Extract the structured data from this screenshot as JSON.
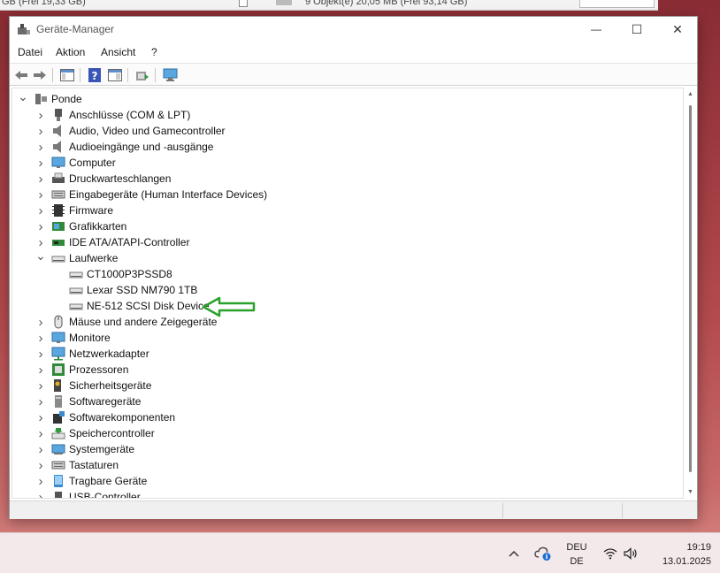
{
  "background_window": {
    "text_left": "GB  (Frei 19,33 GB)",
    "text_right": "9 Objekt(e)   20,05 MB  (Frei 93,14 GB)"
  },
  "window": {
    "title": "Geräte-Manager",
    "controls": {
      "minimize": "—",
      "maximize": "☐",
      "close": "✕"
    }
  },
  "menu": [
    "Datei",
    "Aktion",
    "Ansicht",
    "?"
  ],
  "tree": {
    "root": "Ponde",
    "categories": [
      {
        "label": "Anschlüsse (COM & LPT)",
        "icon": "port-icon",
        "expanded": false
      },
      {
        "label": "Audio, Video und Gamecontroller",
        "icon": "speaker-icon",
        "expanded": false
      },
      {
        "label": "Audioeingänge und -ausgänge",
        "icon": "speaker-icon",
        "expanded": false
      },
      {
        "label": "Computer",
        "icon": "monitor-icon",
        "expanded": false
      },
      {
        "label": "Druckwarteschlangen",
        "icon": "printer-icon",
        "expanded": false
      },
      {
        "label": "Eingabegeräte (Human Interface Devices)",
        "icon": "keyboard-icon",
        "expanded": false
      },
      {
        "label": "Firmware",
        "icon": "chip-icon",
        "expanded": false
      },
      {
        "label": "Grafikkarten",
        "icon": "display-adapter-icon",
        "expanded": false
      },
      {
        "label": "IDE ATA/ATAPI-Controller",
        "icon": "controller-icon",
        "expanded": false
      },
      {
        "label": "Laufwerke",
        "icon": "drive-icon",
        "expanded": true,
        "children": [
          "CT1000P3PSSD8",
          "Lexar SSD NM790 1TB",
          "NE-512  SCSI Disk Device"
        ]
      },
      {
        "label": "Mäuse und andere Zeigegeräte",
        "icon": "mouse-icon",
        "expanded": false
      },
      {
        "label": "Monitore",
        "icon": "monitor-icon",
        "expanded": false
      },
      {
        "label": "Netzwerkadapter",
        "icon": "network-icon",
        "expanded": false
      },
      {
        "label": "Prozessoren",
        "icon": "cpu-icon",
        "expanded": false
      },
      {
        "label": "Sicherheitsgeräte",
        "icon": "security-icon",
        "expanded": false
      },
      {
        "label": "Softwaregeräte",
        "icon": "software-device-icon",
        "expanded": false
      },
      {
        "label": "Softwarekomponenten",
        "icon": "software-component-icon",
        "expanded": false
      },
      {
        "label": "Speichercontroller",
        "icon": "storage-controller-icon",
        "expanded": false
      },
      {
        "label": "Systemgeräte",
        "icon": "system-icon",
        "expanded": false
      },
      {
        "label": "Tastaturen",
        "icon": "keyboard-icon",
        "expanded": false
      },
      {
        "label": "Tragbare Geräte",
        "icon": "portable-device-icon",
        "expanded": false
      },
      {
        "label": "USB-Controller",
        "icon": "usb-icon",
        "expanded": false
      }
    ]
  },
  "annotation": {
    "color": "#2aa12a"
  },
  "taskbar": {
    "lang_top": "DEU",
    "lang_bottom": "DE",
    "time": "19:19",
    "date": "13.01.2025"
  }
}
